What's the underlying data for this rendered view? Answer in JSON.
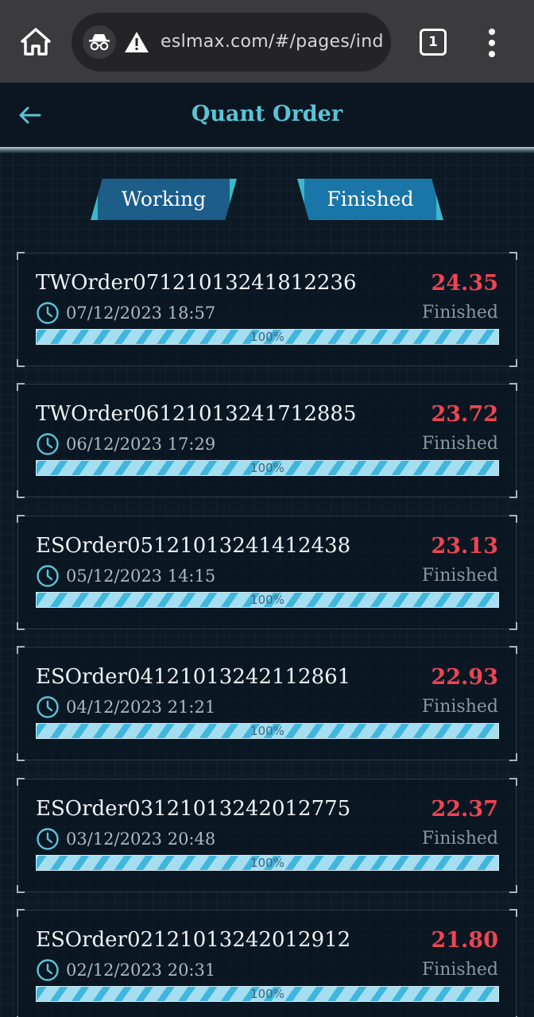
{
  "browser": {
    "url": "eslmax.com/#/pages/ind",
    "tab_count": "1"
  },
  "header": {
    "title": "Quant Order"
  },
  "tabs": [
    {
      "label": "Working",
      "active": false
    },
    {
      "label": "Finished",
      "active": true
    }
  ],
  "colors": {
    "accent": "#5cc3d6",
    "amount": "#ef4452",
    "progress": "#41b6dc"
  },
  "orders": [
    {
      "id": "TWOrder07121013241812236",
      "amount": "24.35",
      "time": "07/12/2023 18:57",
      "status": "Finished",
      "progress_label": "100%",
      "progress": 1.0
    },
    {
      "id": "TWOrder06121013241712885",
      "amount": "23.72",
      "time": "06/12/2023 17:29",
      "status": "Finished",
      "progress_label": "100%",
      "progress": 1.0
    },
    {
      "id": "ESOrder05121013241412438",
      "amount": "23.13",
      "time": "05/12/2023 14:15",
      "status": "Finished",
      "progress_label": "100%",
      "progress": 1.0
    },
    {
      "id": "ESOrder04121013242112861",
      "amount": "22.93",
      "time": "04/12/2023 21:21",
      "status": "Finished",
      "progress_label": "100%",
      "progress": 1.0
    },
    {
      "id": "ESOrder03121013242012775",
      "amount": "22.37",
      "time": "03/12/2023 20:48",
      "status": "Finished",
      "progress_label": "100%",
      "progress": 1.0
    },
    {
      "id": "ESOrder02121013242012912",
      "amount": "21.80",
      "time": "02/12/2023 20:31",
      "status": "Finished",
      "progress_label": "100%",
      "progress": 1.0
    }
  ]
}
